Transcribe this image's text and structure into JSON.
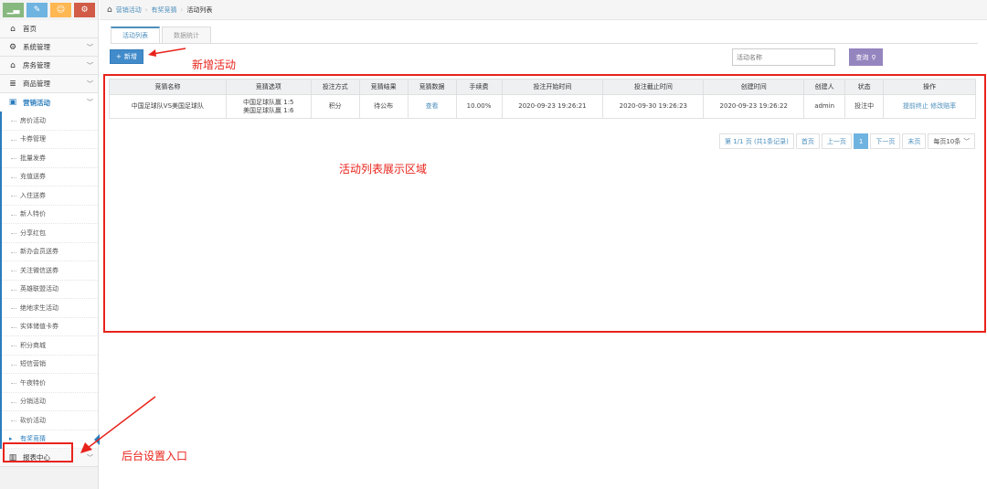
{
  "sidebar": {
    "shortcuts": [
      {
        "icon": "bar-chart-icon",
        "glyph": "▁▃",
        "color": "#87b87f"
      },
      {
        "icon": "pencil-icon",
        "glyph": "✎",
        "color": "#6fb3e0"
      },
      {
        "icon": "users-icon",
        "glyph": "☺",
        "color": "#ffb752"
      },
      {
        "icon": "cogs-icon",
        "glyph": "⚙",
        "color": "#d15b47"
      }
    ],
    "top_items": [
      {
        "label": "首页",
        "icon": "home-icon",
        "glyph": "⌂"
      },
      {
        "label": "系统管理",
        "icon": "gear-icon",
        "glyph": "⚙"
      },
      {
        "label": "房务管理",
        "icon": "bank-icon",
        "glyph": "⌂"
      },
      {
        "label": "商品管理",
        "icon": "database-icon",
        "glyph": "≣"
      },
      {
        "label": "营销活动",
        "icon": "gift-icon",
        "glyph": "▣"
      }
    ],
    "sub_items": [
      "房价活动",
      "卡券管理",
      "批量发券",
      "充值送券",
      "入住送券",
      "新人特价",
      "分享红包",
      "新办会员送券",
      "关注微信送券",
      "英雄联盟活动",
      "绝地求生活动",
      "实体储值卡券",
      "积分商城",
      "短信营销",
      "午夜特价",
      "分销活动",
      "砍价活动",
      "有奖竞猜"
    ],
    "bottom_item": {
      "label": "报表中心",
      "icon": "report-icon",
      "glyph": "▥"
    }
  },
  "breadcrumb": {
    "home_icon": "home-icon",
    "items": [
      "营销活动",
      "有奖竞猜",
      "活动列表"
    ]
  },
  "tabs": [
    "活动列表",
    "数据统计"
  ],
  "toolbar": {
    "add_label": "新增",
    "search_placeholder": "活动名称",
    "search_label": "查询"
  },
  "annotations": {
    "add": "新增活动",
    "list": "活动列表展示区域",
    "entry": "后台设置入口"
  },
  "table": {
    "headers": [
      "竞猜名称",
      "竞猜选项",
      "投注方式",
      "竞猜结果",
      "竞猜数据",
      "手续费",
      "投注开始时间",
      "投注截止时间",
      "创建时间",
      "创建人",
      "状态",
      "操作"
    ],
    "rows": [
      {
        "name": "中国足球队VS美国足球队",
        "option_1": "中国足球队赢 1:5",
        "option_2": "美国足球队赢 1:6",
        "method": "积分",
        "result": "待公布",
        "data_link": "查看",
        "fee": "10.00%",
        "start": "2020-09-23 19:26:21",
        "end": "2020-09-30 19:26:23",
        "created": "2020-09-23 19:26:22",
        "creator": "admin",
        "status": "投注中",
        "action_1": "提前终止",
        "action_2": "修改赔率"
      }
    ]
  },
  "pager": {
    "summary": "第 1/1 页 (共1条记录)",
    "first": "首页",
    "prev": "上一页",
    "current": "1",
    "next": "下一页",
    "last": "末页",
    "page_size": "每页10条"
  },
  "colors": {
    "accent": "#2b7dbc",
    "annotation": "#e8231b"
  }
}
